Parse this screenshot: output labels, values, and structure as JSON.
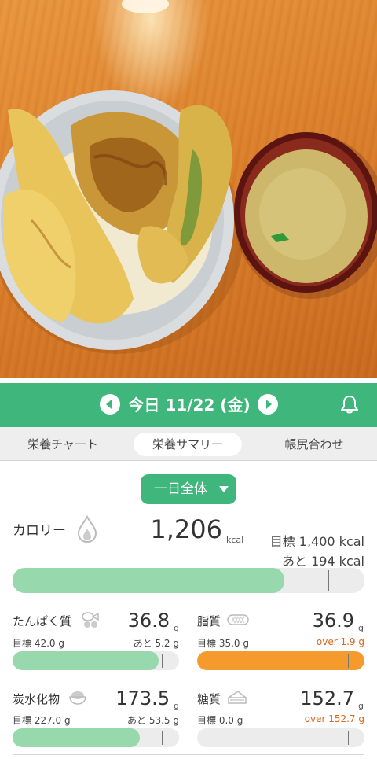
{
  "header": {
    "date": "今日 11/22 (金)",
    "prev_icon": "chevron-left-icon",
    "next_icon": "chevron-right-icon",
    "bell_icon": "bell-icon",
    "color": "#3fb67c"
  },
  "tabs": [
    {
      "label": "栄養チャート",
      "active": false
    },
    {
      "label": "栄養サマリー",
      "active": true
    },
    {
      "label": "帳尻合わせ",
      "active": false
    }
  ],
  "period": {
    "label": "一日全体",
    "icon": "caret-down-icon"
  },
  "calories": {
    "label": "カロリー",
    "icon": "flame-icon",
    "value": "1,206",
    "unit": "kcal",
    "target": "目標 1,400 kcal",
    "remaining": "あと 194 kcal",
    "progress": 0.861
  },
  "nutrients": [
    {
      "key": "protein",
      "name": "たんぱく質",
      "icon": "protein-foods-icon",
      "value": "36.8",
      "unit": "g",
      "target": "目標 42.0 g",
      "remaining": "あと 5.2 g",
      "over": false,
      "progress": 0.876,
      "color": "#97d9ad"
    },
    {
      "key": "fat",
      "name": "脂質",
      "icon": "fat-icon",
      "value": "36.9",
      "unit": "g",
      "target": "目標 35.0 g",
      "remaining": "over 1.9 g",
      "over": true,
      "progress": 1.0,
      "color": "#f59a2d"
    },
    {
      "key": "carbs",
      "name": "炭水化物",
      "icon": "rice-bowl-icon",
      "value": "173.5",
      "unit": "g",
      "target": "目標 227.0 g",
      "remaining": "あと 53.5 g",
      "over": false,
      "progress": 0.764,
      "color": "#97d9ad"
    },
    {
      "key": "sugar",
      "name": "糖質",
      "icon": "cake-icon",
      "value": "152.7",
      "unit": "g",
      "target": "目標 0.0 g",
      "remaining": "over 152.7 g",
      "over": true,
      "progress": 0.0,
      "color": "#f59a2d"
    }
  ],
  "colors": {
    "accent": "#3fb67c",
    "bar_ok": "#97d9ad",
    "bar_over": "#f59a2d",
    "over_text": "#d9661f"
  }
}
